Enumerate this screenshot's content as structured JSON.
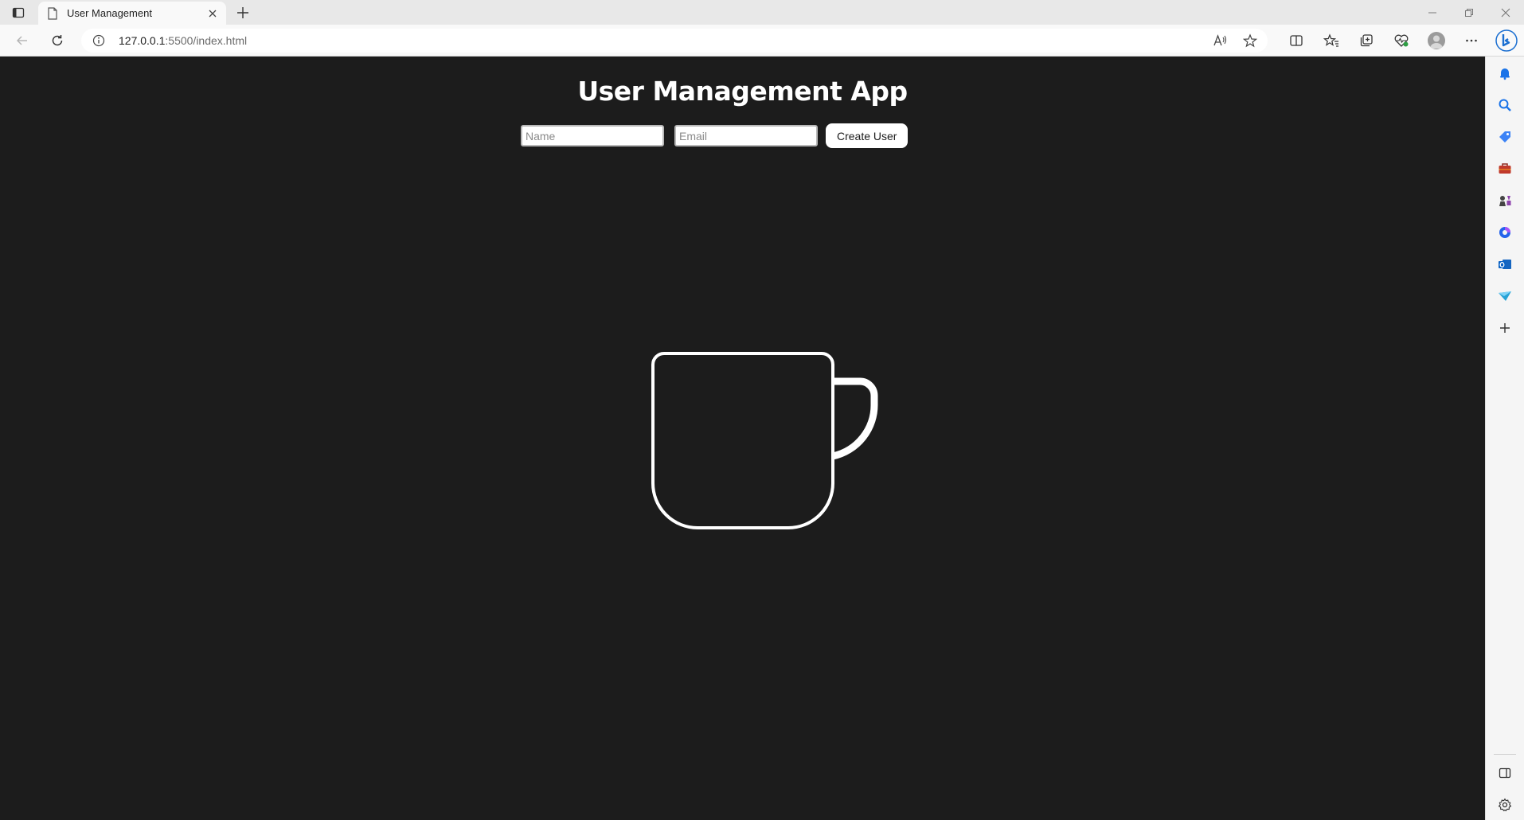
{
  "browser": {
    "tab_title": "User Management",
    "url_host": "127.0.0.1",
    "url_rest": ":5500/index.html",
    "sidebar_icons": [
      "bell-icon",
      "search-icon",
      "tag-icon",
      "toolbox-icon",
      "games-icon",
      "office-icon",
      "outlook-icon",
      "drop-icon",
      "add-icon",
      "sidebar-toggle-icon",
      "settings-icon"
    ]
  },
  "app": {
    "title": "User Management App",
    "name_placeholder": "Name",
    "email_placeholder": "Email",
    "create_label": "Create User"
  },
  "illustration": {
    "name": "mug-illustration",
    "stroke_color": "#ffffff",
    "background": "#1c1c1c"
  }
}
